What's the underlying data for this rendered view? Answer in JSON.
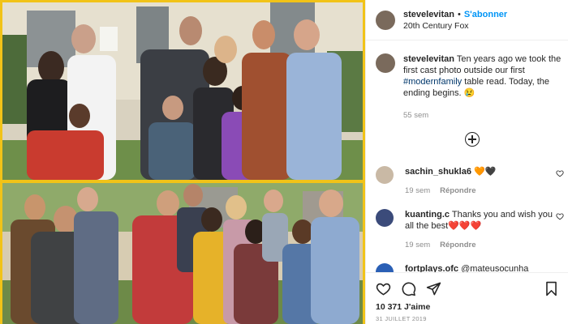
{
  "post": {
    "username": "stevelevitan",
    "follow_label": "S'abonner",
    "location": "20th Century Fox",
    "caption_text": "Ten years ago we took the first cast photo outside our first",
    "caption_hashtag": "#modernfamily",
    "caption_text_end": "table read. Today, the ending begins. 😢",
    "caption_time": "55 sem"
  },
  "comments": [
    {
      "username": "sachin_shukla6",
      "text": "🧡🖤",
      "time": "19 sem",
      "reply_label": "Répondre"
    },
    {
      "username": "kuanting.c",
      "text": "Thanks you and wish you all the best❤️❤️❤️",
      "time": "19 sem",
      "reply_label": "Répondre"
    },
    {
      "username": "fortplays.ofc",
      "text": "@mateusocunha",
      "time": "",
      "reply_label": ""
    }
  ],
  "footer": {
    "likes": "10 371 J'aime",
    "date": "31 JUILLET 2019"
  },
  "icons": {
    "like": "heart-icon",
    "comment": "comment-icon",
    "share": "send-icon",
    "save": "bookmark-icon",
    "add_comments": "plus-circle-icon"
  },
  "colors": {
    "accent": "#0095f6",
    "photo_border": "#f1c318",
    "hashtag": "#00376b",
    "muted": "#8e8e8e"
  }
}
